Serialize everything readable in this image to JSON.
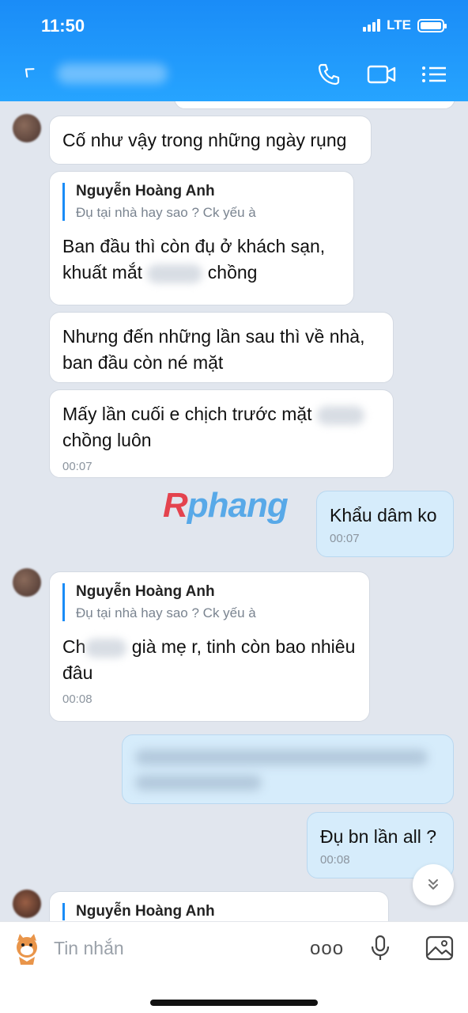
{
  "status": {
    "time": "11:50",
    "network": "LTE"
  },
  "header": {
    "back_icon": "chevron-left-icon"
  },
  "messages": [
    {
      "text": "Cố như vậy trong những ngày rụng"
    },
    {
      "quote_name": "Nguyễn Hoàng Anh",
      "quote_text": "Đụ tại nhà hay sao ? Ck yếu à",
      "text_a": "Ban đầu thì còn đụ ở khách sạn,",
      "text_b": "khuất mắt",
      "text_c": "chồng"
    },
    {
      "text": "Nhưng đến những lần sau thì về nhà, ban đầu còn né mặt"
    },
    {
      "text_a": "Mấy lần cuối e chịch trước mặt",
      "text_b": "chồng luôn",
      "time": "00:07"
    },
    {
      "text": "Khẩu dâm ko",
      "time": "00:07"
    },
    {
      "quote_name": "Nguyễn Hoàng Anh",
      "quote_text": "Đụ tại nhà hay sao ? Ck yếu à",
      "text_a": "Ch",
      "text_b": "già mẹ r, tinh còn bao nhiêu",
      "text_c": "đâu",
      "time": "00:08"
    },
    {
      "text": "Đụ bn lần all ?",
      "time": "00:08"
    },
    {
      "quote_name": "Nguyễn Hoàng Anh"
    }
  ],
  "watermark": {
    "r": "R",
    "rest": "phang"
  },
  "input": {
    "placeholder": "Tin nhắn",
    "more": "ooo"
  },
  "colors": {
    "header": "#1a8cf7",
    "my_bubble": "#d6ecfb",
    "background": "#e1e6ee"
  }
}
